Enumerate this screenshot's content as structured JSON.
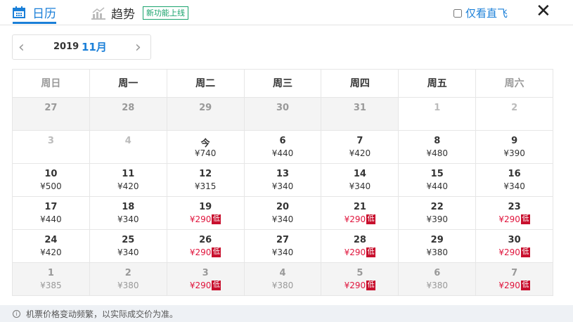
{
  "tabs": {
    "calendar": "日历",
    "trend": "趋势",
    "new_badge": "新功能上线"
  },
  "direct_only": {
    "label": "仅看直飞",
    "checked": false
  },
  "close": "✕",
  "nav": {
    "year": "2019",
    "month": "11月",
    "prev": "‹",
    "next": "›"
  },
  "weekdays": [
    "周日",
    "周一",
    "周二",
    "周三",
    "周四",
    "周五",
    "周六"
  ],
  "low_label": "低",
  "weeks": [
    [
      {
        "d": "27",
        "t": "prev"
      },
      {
        "d": "28",
        "t": "prev"
      },
      {
        "d": "29",
        "t": "prev"
      },
      {
        "d": "30",
        "t": "prev"
      },
      {
        "d": "31",
        "t": "prev"
      },
      {
        "d": "1",
        "t": "past"
      },
      {
        "d": "2",
        "t": "past"
      }
    ],
    [
      {
        "d": "3",
        "t": "past"
      },
      {
        "d": "4",
        "t": "past"
      },
      {
        "d": "今",
        "p": "¥740"
      },
      {
        "d": "6",
        "p": "¥440"
      },
      {
        "d": "7",
        "p": "¥420"
      },
      {
        "d": "8",
        "p": "¥480"
      },
      {
        "d": "9",
        "p": "¥390"
      }
    ],
    [
      {
        "d": "10",
        "p": "¥500"
      },
      {
        "d": "11",
        "p": "¥420"
      },
      {
        "d": "12",
        "p": "¥315"
      },
      {
        "d": "13",
        "p": "¥340"
      },
      {
        "d": "14",
        "p": "¥340"
      },
      {
        "d": "15",
        "p": "¥440"
      },
      {
        "d": "16",
        "p": "¥340"
      }
    ],
    [
      {
        "d": "17",
        "p": "¥440"
      },
      {
        "d": "18",
        "p": "¥340"
      },
      {
        "d": "19",
        "p": "¥290",
        "low": true
      },
      {
        "d": "20",
        "p": "¥340"
      },
      {
        "d": "21",
        "p": "¥290",
        "low": true
      },
      {
        "d": "22",
        "p": "¥390"
      },
      {
        "d": "23",
        "p": "¥290",
        "low": true
      }
    ],
    [
      {
        "d": "24",
        "p": "¥420"
      },
      {
        "d": "25",
        "p": "¥340"
      },
      {
        "d": "26",
        "p": "¥290",
        "low": true
      },
      {
        "d": "27",
        "p": "¥340"
      },
      {
        "d": "28",
        "p": "¥290",
        "low": true
      },
      {
        "d": "29",
        "p": "¥380"
      },
      {
        "d": "30",
        "p": "¥290",
        "low": true
      }
    ],
    [
      {
        "d": "1",
        "p": "¥385",
        "t": "next"
      },
      {
        "d": "2",
        "p": "¥380",
        "t": "next"
      },
      {
        "d": "3",
        "p": "¥290",
        "low": true,
        "t": "next"
      },
      {
        "d": "4",
        "p": "¥380",
        "t": "next"
      },
      {
        "d": "5",
        "p": "¥290",
        "low": true,
        "t": "next"
      },
      {
        "d": "6",
        "p": "¥380",
        "t": "next"
      },
      {
        "d": "7",
        "p": "¥290",
        "low": true,
        "t": "next"
      }
    ]
  ],
  "footer": "机票价格变动频繁，以实际成交价为准。"
}
